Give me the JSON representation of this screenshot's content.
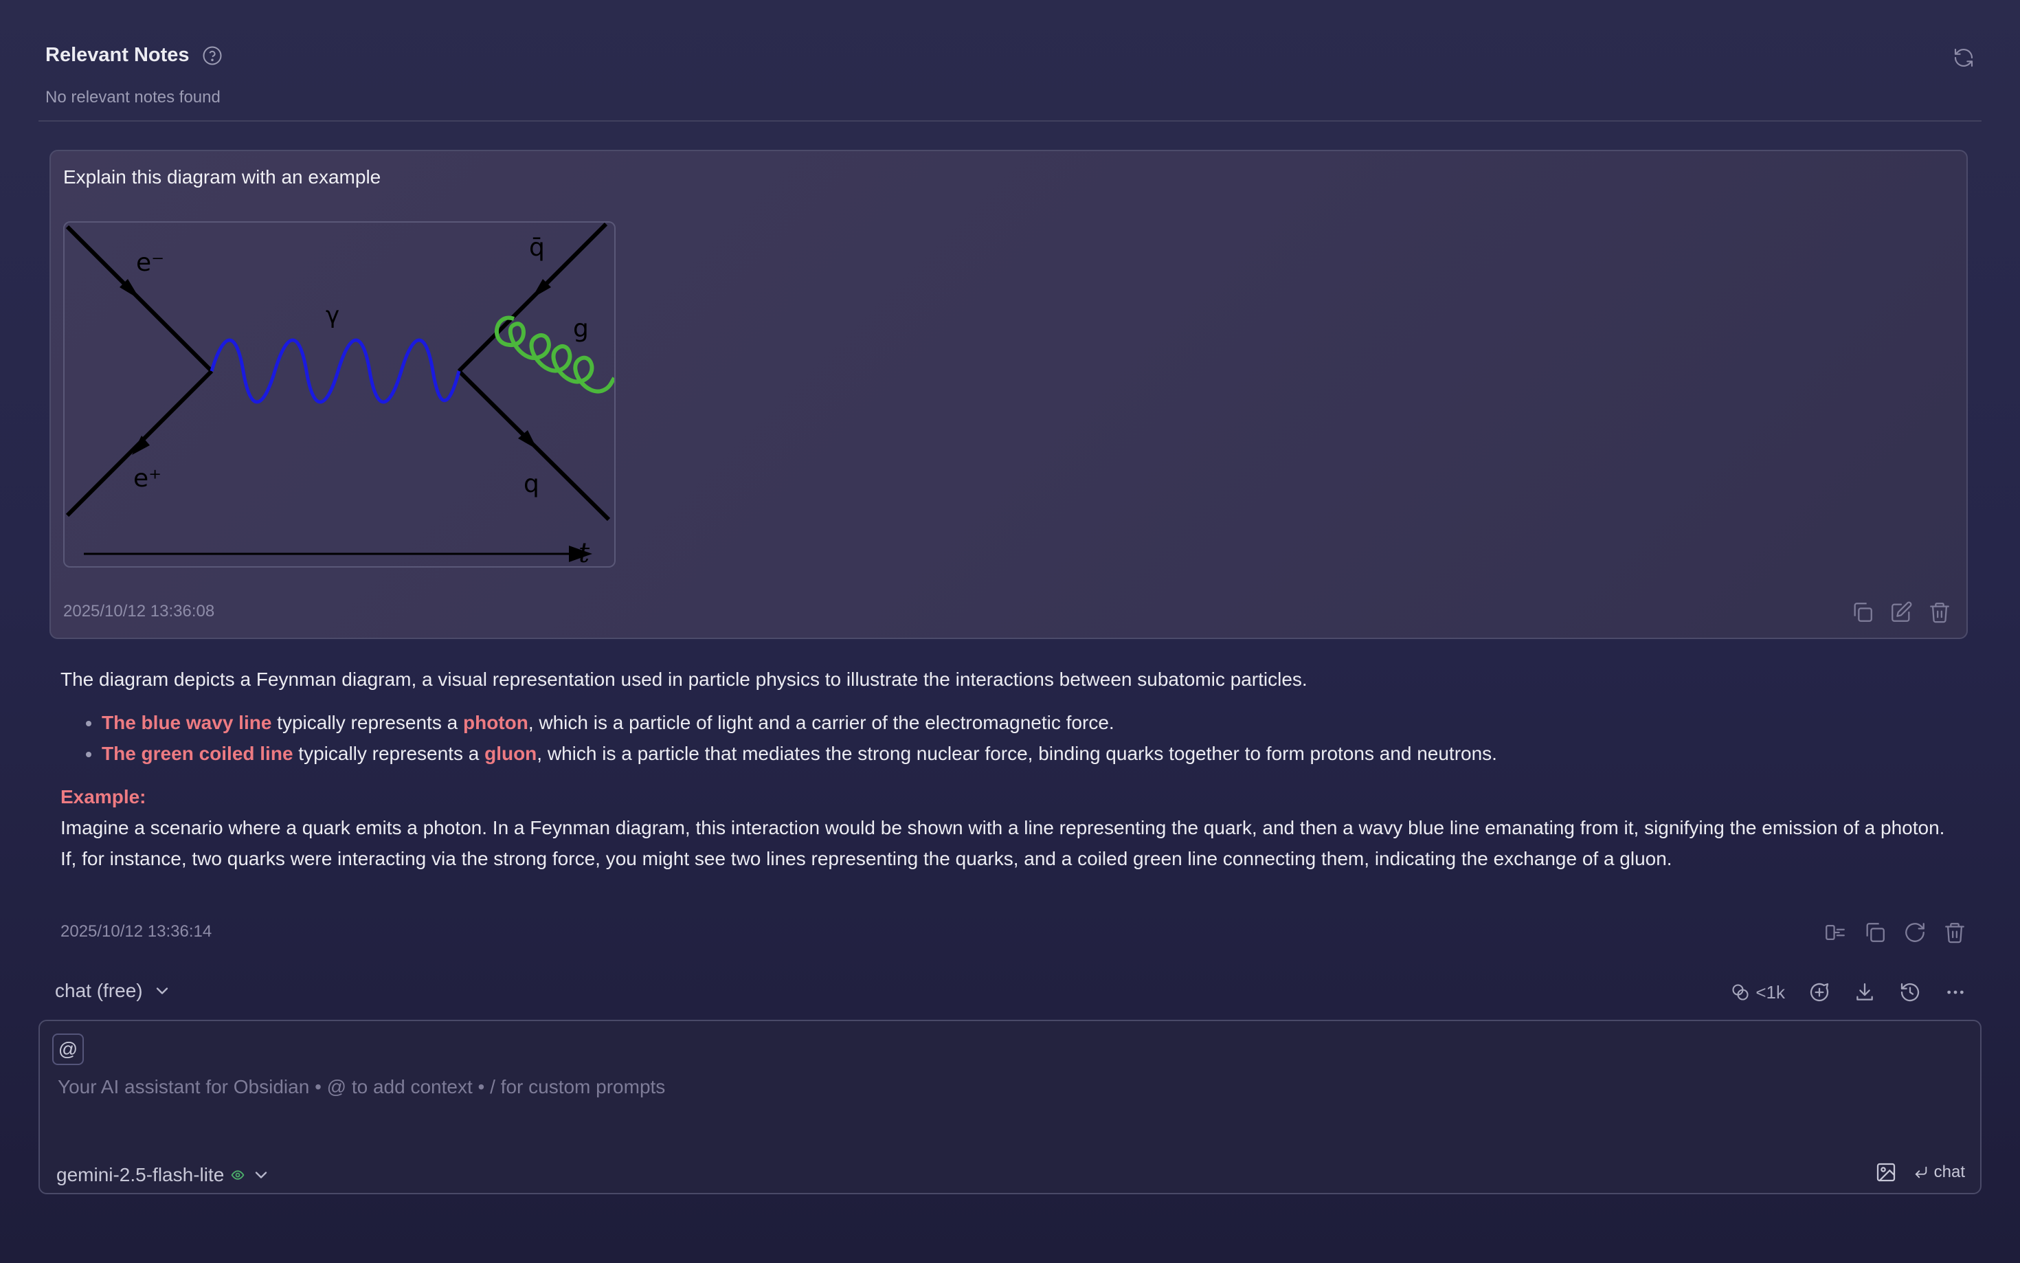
{
  "relevant_notes": {
    "title": "Relevant Notes",
    "empty_message": "No relevant notes found"
  },
  "user_message": {
    "text": "Explain this diagram with an example",
    "timestamp": "2025/10/12 13:36:08",
    "diagram_labels": {
      "electron": "e⁻",
      "positron": "e⁺",
      "photon": "γ",
      "antiquark": "q̄",
      "quark": "q",
      "gluon": "g",
      "time_axis": "t"
    }
  },
  "ai_response": {
    "intro": "The diagram depicts a Feynman diagram, a visual representation used in particle physics to illustrate the interactions between subatomic particles.",
    "bullets": [
      {
        "subject": "The blue wavy line",
        "mid": " typically represents a ",
        "term": "photon",
        "rest": ", which is a particle of light and a carrier of the electromagnetic force."
      },
      {
        "subject": "The green coiled line",
        "mid": " typically represents a ",
        "term": "gluon",
        "rest": ", which is a particle that mediates the strong nuclear force, binding quarks together to form protons and neutrons."
      }
    ],
    "example_label": "Example:",
    "example_para1": "Imagine a scenario where a quark emits a photon. In a Feynman diagram, this interaction would be shown with a line representing the quark, and then a wavy blue line emanating from it, signifying the emission of a photon.",
    "example_para2": "If, for instance, two quarks were interacting via the strong force, you might see two lines representing the quarks, and a coiled green line connecting them, indicating the exchange of a gluon.",
    "timestamp": "2025/10/12 13:36:14"
  },
  "chat_mode": {
    "label": "chat (free)"
  },
  "toolbar": {
    "token_count": "<1k"
  },
  "input": {
    "at_label": "@",
    "placeholder": "Your AI assistant for Obsidian • @ to add context • / for custom prompts",
    "value": "",
    "model": "gemini-2.5-flash-lite",
    "send_label": "chat"
  },
  "colors": {
    "highlight": "#ee7b82",
    "photon_line": "#1a1adf",
    "gluon_line": "#4cb83c"
  }
}
